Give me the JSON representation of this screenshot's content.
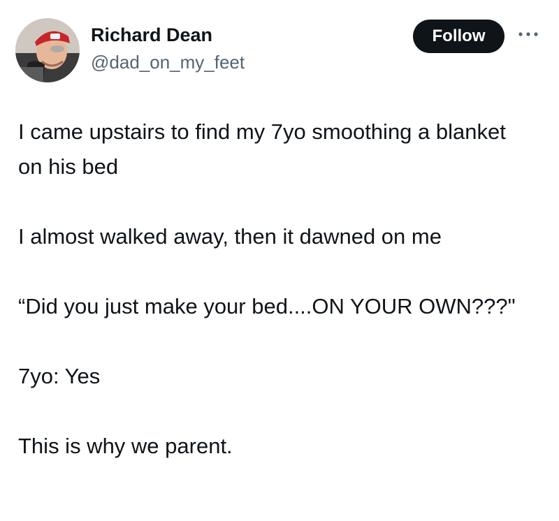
{
  "author": {
    "display_name": "Richard Dean",
    "handle": "@dad_on_my_feet",
    "avatar_icon": "profile-photo"
  },
  "actions": {
    "follow_label": "Follow",
    "more_icon": "more-options-icon"
  },
  "tweet": {
    "paragraphs": [
      "I came upstairs to find my 7yo smoothing a blanket on his bed",
      "I almost walked away, then it dawned on me",
      "“Did you just make your bed....ON YOUR OWN???\"",
      "7yo: Yes",
      "This is why we parent."
    ]
  },
  "colors": {
    "text": "#0f1419",
    "secondary_text": "#536471",
    "follow_bg": "#0f1419",
    "follow_text": "#ffffff"
  }
}
